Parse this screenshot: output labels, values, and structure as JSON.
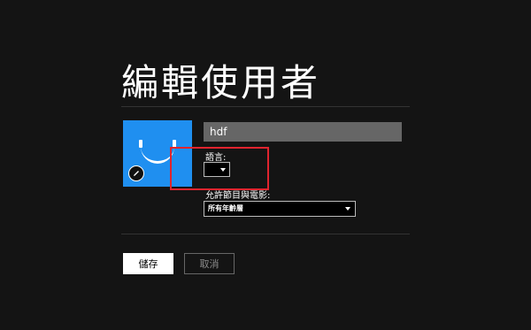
{
  "page": {
    "title": "編輯使用者"
  },
  "profile": {
    "name_value": "hdf",
    "avatar_icon": "smiley-face-avatar",
    "edit_icon": "pencil-icon",
    "avatar_color": "#1f8ff0"
  },
  "language": {
    "label": "語言:",
    "selected": ""
  },
  "maturity": {
    "label": "允許節目與電影:",
    "selected": "所有年齡層"
  },
  "actions": {
    "save_label": "儲存",
    "cancel_label": "取消"
  },
  "annotation": {
    "highlight_color": "#e0242e"
  }
}
